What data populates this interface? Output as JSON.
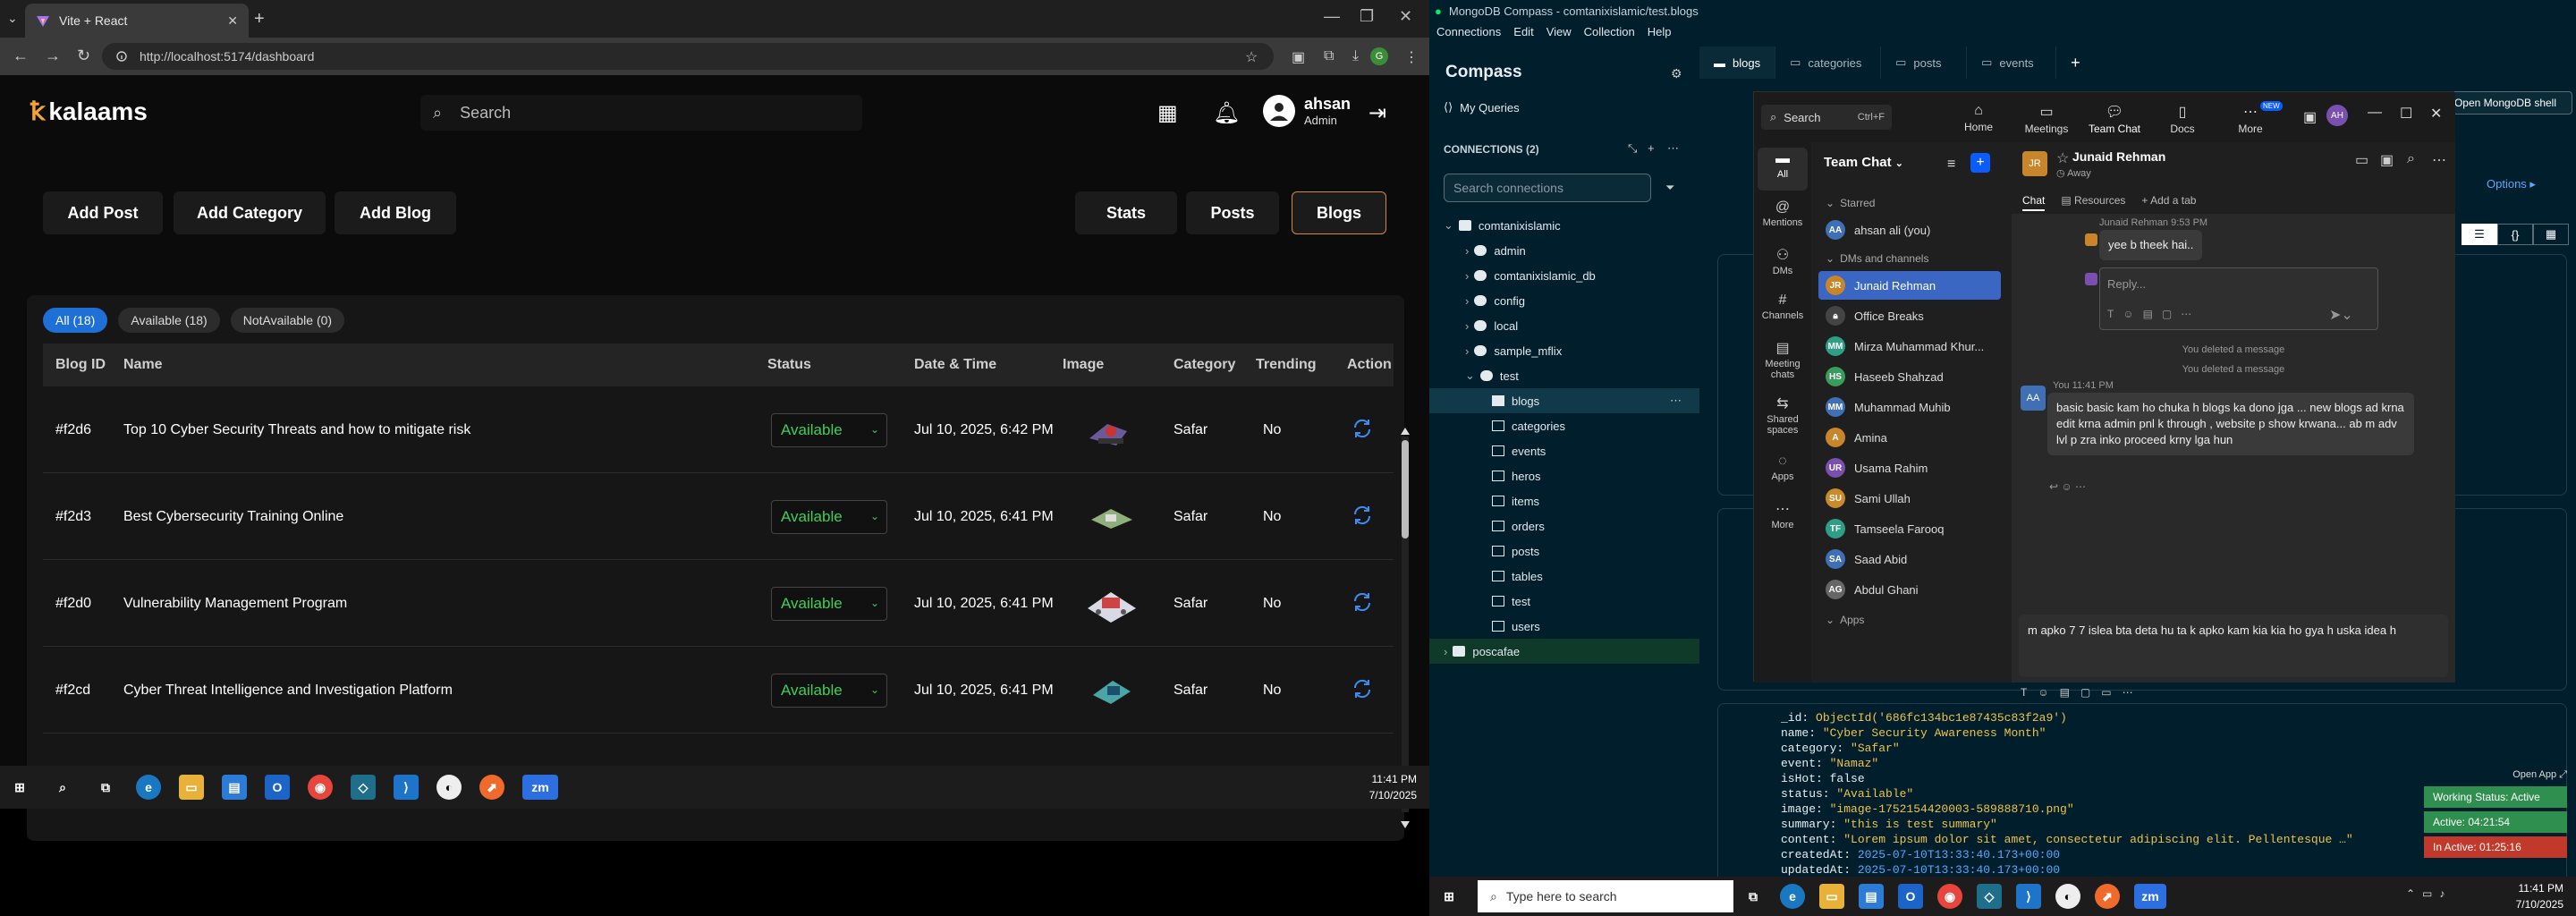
{
  "chrome": {
    "tab_title": "Vite + React",
    "url": "http://localhost:5174/dashboard"
  },
  "app": {
    "logo": "kalaams",
    "search_placeholder": "Search",
    "user_name": "ahsan",
    "user_role": "Admin",
    "actions_left": [
      "Add Post",
      "Add Category",
      "Add Blog"
    ],
    "actions_right": [
      "Stats",
      "Posts",
      "Blogs"
    ],
    "filters": [
      "All (18)",
      "Available (18)",
      "NotAvailable (0)"
    ],
    "columns": [
      "Blog ID",
      "Name",
      "Status",
      "Date & Time",
      "Image",
      "Category",
      "Trending",
      "Action"
    ],
    "rows": [
      {
        "id": "#f2d6",
        "name": "Top 10 Cyber Security Threats and how to mitigate risk",
        "status": "Available",
        "date": "Jul 10, 2025, 6:42 PM",
        "category": "Safar",
        "trending": "No"
      },
      {
        "id": "#f2d3",
        "name": "Best Cybersecurity Training Online",
        "status": "Available",
        "date": "Jul 10, 2025, 6:41 PM",
        "category": "Safar",
        "trending": "No"
      },
      {
        "id": "#f2d0",
        "name": "Vulnerability Management Program",
        "status": "Available",
        "date": "Jul 10, 2025, 6:41 PM",
        "category": "Safar",
        "trending": "No"
      },
      {
        "id": "#f2cd",
        "name": "Cyber Threat Intelligence and Investigation Platform",
        "status": "Available",
        "date": "Jul 10, 2025, 6:41 PM",
        "category": "Safar",
        "trending": "No"
      }
    ]
  },
  "taskbar_left": {
    "time": "11:41 PM",
    "date": "7/10/2025"
  },
  "compass": {
    "title": "MongoDB Compass - comtanixislamic/test.blogs",
    "menu": [
      "Connections",
      "Edit",
      "View",
      "Collection",
      "Help"
    ],
    "heading": "Compass",
    "my_queries": "My Queries",
    "connections_label": "CONNECTIONS (2)",
    "search_placeholder": "Search connections",
    "tree": [
      "comtanixislamic",
      "admin",
      "comtanixislamic_db",
      "config",
      "local",
      "sample_mflix",
      "test",
      "blogs",
      "categories",
      "events",
      "heros",
      "items",
      "orders",
      "posts",
      "tables",
      "test",
      "users",
      "poscafae"
    ],
    "tabs": [
      "blogs",
      "categories",
      "posts",
      "events"
    ],
    "doc_lines": [
      {
        "k": "_id: ",
        "v": "ObjectId('686fc134bc1e87435c83f2a9')"
      },
      {
        "k": "name: ",
        "v": "\"Cyber Security Awareness Month\""
      },
      {
        "k": "category: ",
        "v": "\"Safar\""
      },
      {
        "k": "event: ",
        "v": "\"Namaz\""
      },
      {
        "k": "isHot: ",
        "v": "false"
      },
      {
        "k": "status: ",
        "v": "\"Available\""
      },
      {
        "k": "image: ",
        "v": "\"image-1752154420003-589888710.png\""
      },
      {
        "k": "summary: ",
        "v": "\"this is test summary\""
      },
      {
        "k": "content: ",
        "v": "\"Lorem ipsum dolor sit amet, consectetur adipiscing elit. Pellentesque …\""
      },
      {
        "k": "createdAt: ",
        "v": "2025-07-10T13:33:40.173+00:00"
      },
      {
        "k": "updatedAt: ",
        "v": "2025-07-10T13:33:40.173+00:00"
      }
    ],
    "mongo_shell": "Open MongoDB shell",
    "options": "Options"
  },
  "teams": {
    "search": "Search",
    "shortcut": "Ctrl+F",
    "nav": [
      "Home",
      "Meetings",
      "Team Chat",
      "Docs",
      "More"
    ],
    "new_badge": "NEW",
    "rail": [
      "All",
      "Mentions",
      "DMs",
      "Channels",
      "Meeting chats",
      "Shared spaces",
      "Apps",
      "More"
    ],
    "list_title": "Team Chat",
    "starred": "Starred",
    "starred_item": "ahsan ali (you)",
    "dms_header": "DMs and channels",
    "contacts": [
      "Junaid Rehman",
      "Office Breaks",
      "Mirza Muhammad Khur...",
      "Haseeb Shahzad",
      "Muhammad Muhib",
      "Amina",
      "Usama Rahim",
      "Sami Ullah",
      "Tamseela Farooq",
      "Saad Abid",
      "Abdul Ghani"
    ],
    "apps": "Apps",
    "chat_name": "Junaid Rehman",
    "chat_status": "Away",
    "chat_tabs": [
      "Chat",
      "Resources",
      "Add a tab"
    ],
    "reply_meta": "Junaid Rehman 9:53 PM",
    "reply_text": "yee b theek hai..",
    "reply_placeholder": "Reply...",
    "deleted1": "You deleted a message",
    "deleted2": "You deleted a message",
    "my_meta": "You 11:41 PM",
    "my_text": "basic basic kam ho chuka h blogs ka  dono jga ... new blogs ad krna edit krna admin pnl k through , website p show krwana... ab m adv lvl p zra inko proceed krny lga hun",
    "composer": "m apko 7 7 islea bta deta hu ta k apko kam kia kia ho gya h uska idea h"
  },
  "taskbar_right": {
    "search": "Type here to search",
    "time": "11:41 PM",
    "date": "7/10/2025"
  },
  "status_widget": {
    "open_app": "Open App",
    "working": "Working Status: Active",
    "active": "Active: 04:21:54",
    "inactive": "In Active: 01:25:16"
  }
}
